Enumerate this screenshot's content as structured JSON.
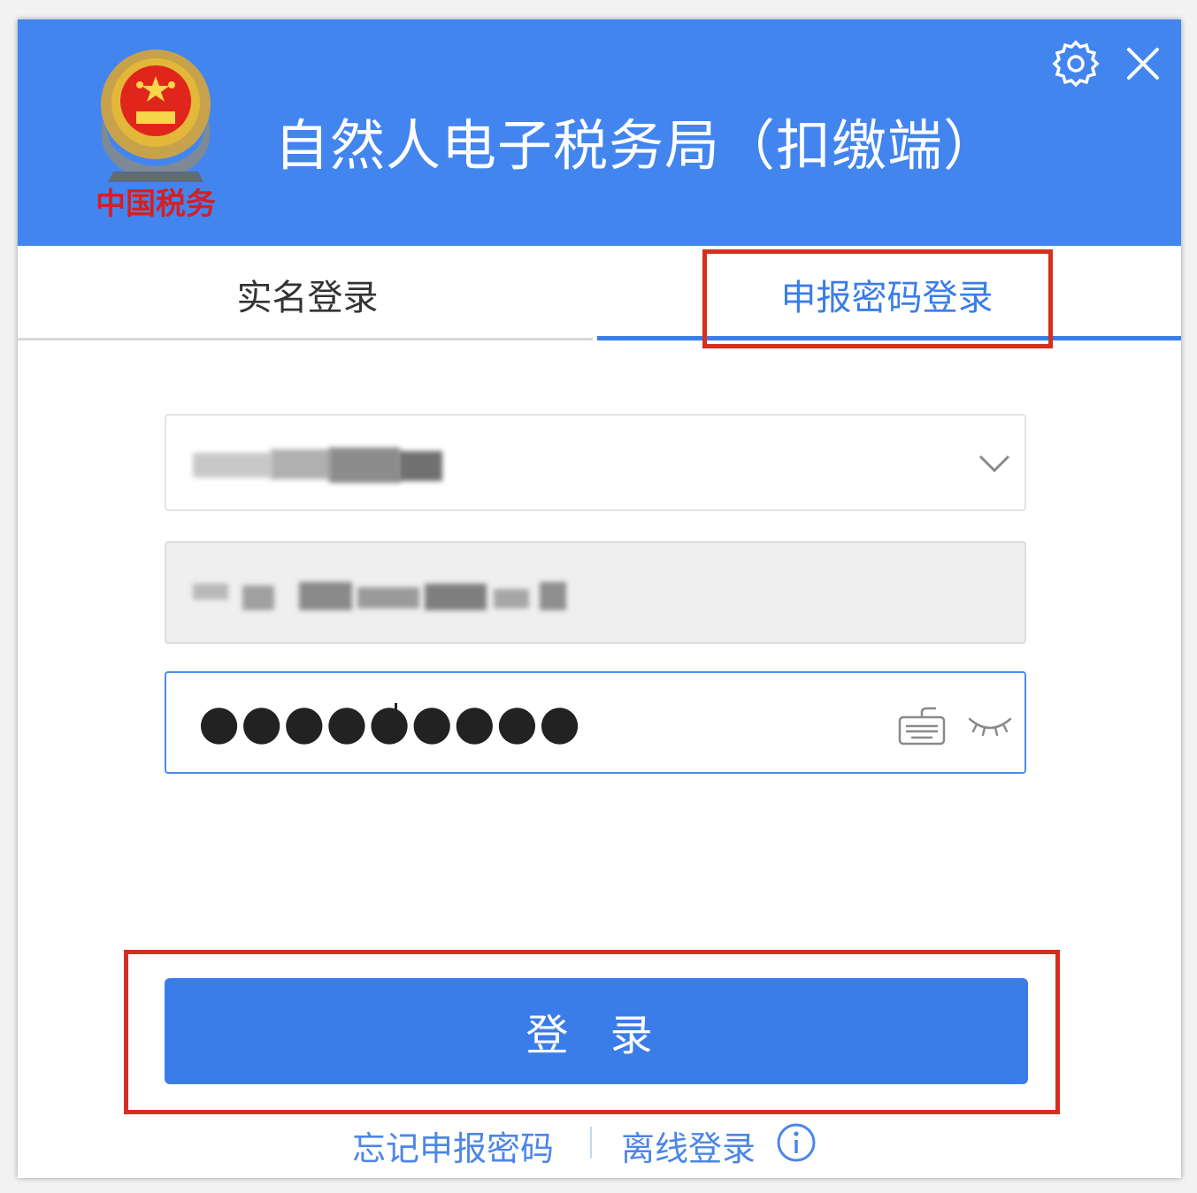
{
  "header": {
    "title": "自然人电子税务局（扣缴端）",
    "emblem_caption": "中国税务",
    "brand_color": "#4385ee"
  },
  "tabs": [
    {
      "label": "实名登录",
      "active": false
    },
    {
      "label": "申报密码登录",
      "active": true
    }
  ],
  "form": {
    "account_field": {
      "state": "blurred / obscured"
    },
    "taxpayer_field": {
      "state": "blurred / obscured"
    },
    "password_field": {
      "value": "●●●●●●●●●"
    }
  },
  "login_button": {
    "label": "登 录"
  },
  "footer": {
    "forgot_link": "忘记申报密码",
    "offline_link": "离线登录"
  },
  "highlight_color": "#d3301f",
  "icons": [
    "gear-icon",
    "close-icon",
    "chevron-down-icon",
    "keyboard-icon",
    "eye-closed-icon",
    "info-icon"
  ]
}
